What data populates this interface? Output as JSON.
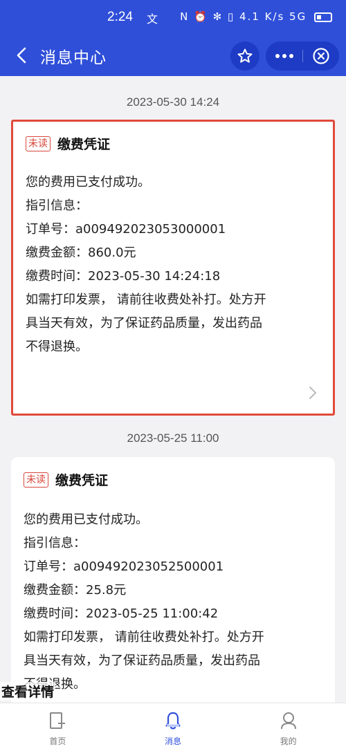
{
  "status_bar": {
    "time": "2:24",
    "extra": "文",
    "icons": "N ⏰ ✻ ▯ 4.1 K/s 5G",
    "battery": "battery-low"
  },
  "nav": {
    "title": "消息中心",
    "back_icon": "chevron-left-icon",
    "star_icon": "star-icon",
    "more_icon": "more-dots-icon",
    "close_icon": "close-circle-icon"
  },
  "messages": [
    {
      "date": "2023-05-30 14:24",
      "badge": "未读",
      "title": "缴费凭证",
      "lines": [
        "您的费用已支付成功。",
        "指引信息：",
        "订单号：a009492023053000001",
        "缴费金额：860.0元",
        "缴费时间：2023-05-30 14:24:18",
        "如需打印发票，  请前往收费处补打。处方开",
        "具当天有效，为了保证药品质量，发出药品",
        "不得退换。"
      ]
    },
    {
      "date": "2023-05-25 11:00",
      "badge": "未读",
      "title": "缴费凭证",
      "lines": [
        "您的费用已支付成功。",
        "指引信息：",
        "订单号：a009492023052500001",
        "缴费金额：25.8元",
        "缴费时间：2023-05-25 11:00:42",
        "如需打印发票，  请前往收费处补打。处方开",
        "具当天有效，为了保证药品质量，发出药品",
        "不得退换。"
      ]
    }
  ],
  "overlay": {
    "view_details": "查看详情"
  },
  "tabs": [
    {
      "label": "首页",
      "icon": "home-icon",
      "active": false
    },
    {
      "label": "消息",
      "icon": "bell-icon",
      "active": true
    },
    {
      "label": "我的",
      "icon": "user-icon",
      "active": false
    }
  ],
  "colors": {
    "brand": "#2f4fd9",
    "unread": "#d8463a",
    "highlight_border": "#e04a3a"
  }
}
